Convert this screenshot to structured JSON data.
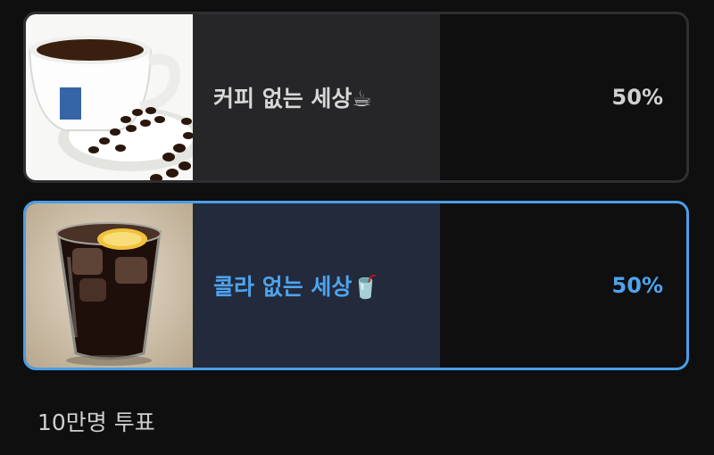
{
  "poll": {
    "options": [
      {
        "label": "커피 없는 세상☕",
        "percent_text": "50%",
        "share": 0.5,
        "image_icon": "coffee-cup-photo",
        "selected": false
      },
      {
        "label": "콜라 없는 세상🥤",
        "percent_text": "50%",
        "share": 0.5,
        "image_icon": "iced-cola-glass-photo",
        "selected": true
      }
    ],
    "vote_count_text": "10만명 투표"
  },
  "colors": {
    "background": "#0f0f10",
    "accent": "#4ea3ee",
    "selected_border": "#4a9ee8",
    "unselected_fill": "#262628",
    "selected_fill": "#222a3b"
  }
}
